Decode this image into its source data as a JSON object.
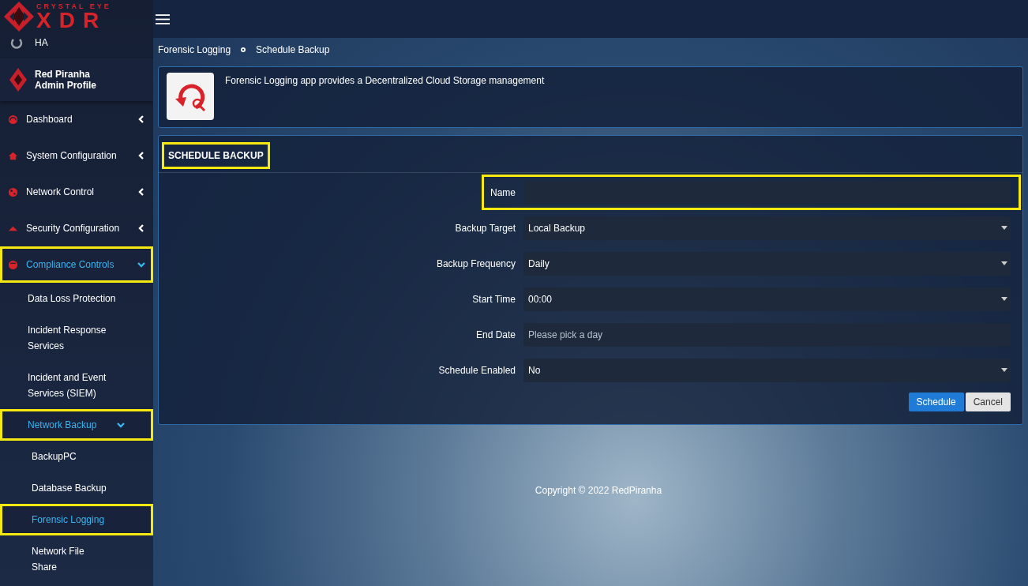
{
  "logo": {
    "tagline": "CRYSTAL EYE",
    "wordmark": "XDR"
  },
  "sidebar": {
    "ha_label": "HA",
    "profile": {
      "name": "Red Piranha",
      "role": "Admin Profile"
    },
    "menu": [
      {
        "label": "Dashboard",
        "expanded": false,
        "highlighted": false
      },
      {
        "label": "System Configuration",
        "expanded": false,
        "highlighted": false
      },
      {
        "label": "Network Control",
        "expanded": false,
        "highlighted": false
      },
      {
        "label": "Security Configuration",
        "expanded": false,
        "highlighted": false
      },
      {
        "label": "Compliance Controls",
        "expanded": true,
        "highlighted": true,
        "children": [
          {
            "label": "Data Loss Protection",
            "selected": false,
            "highlighted": false
          },
          {
            "label": "Incident Response Services",
            "selected": false,
            "highlighted": false
          },
          {
            "label": "Incident and Event Services (SIEM)",
            "selected": false,
            "highlighted": false
          },
          {
            "label": "Network Backup",
            "expanded": true,
            "highlighted": true,
            "children": [
              {
                "label": "BackupPC",
                "selected": false,
                "highlighted": false
              },
              {
                "label": "Database Backup",
                "selected": false,
                "highlighted": false
              },
              {
                "label": "Forensic Logging",
                "selected": true,
                "highlighted": true
              },
              {
                "label": "Network File Share",
                "selected": false,
                "highlighted": false
              }
            ]
          }
        ]
      }
    ]
  },
  "breadcrumb": [
    "Forensic Logging",
    "Schedule Backup"
  ],
  "app_info": {
    "description": "Forensic Logging app provides a Decentralized Cloud Storage management"
  },
  "form": {
    "title": "SCHEDULE BACKUP",
    "title_highlighted": true,
    "fields": [
      {
        "label": "Name",
        "kind": "text",
        "highlighted": true
      },
      {
        "label": "Backup Target",
        "kind": "select",
        "value": "Local Backup",
        "highlighted": false
      },
      {
        "label": "Backup Frequency",
        "kind": "select",
        "value": "Daily",
        "highlighted": false
      },
      {
        "label": "Start Time",
        "kind": "select",
        "value": "00:00",
        "highlighted": false
      },
      {
        "label": "End Date",
        "kind": "date",
        "placeholder": "Please pick a day",
        "highlighted": false
      },
      {
        "label": "Schedule Enabled",
        "kind": "select",
        "value": "No",
        "highlighted": false
      }
    ],
    "buttons": [
      {
        "label": "Schedule",
        "kind": "primary"
      },
      {
        "label": "Cancel",
        "kind": "secondary"
      }
    ]
  },
  "footer": {
    "copyright": "Copyright © 2022 RedPiranha"
  }
}
